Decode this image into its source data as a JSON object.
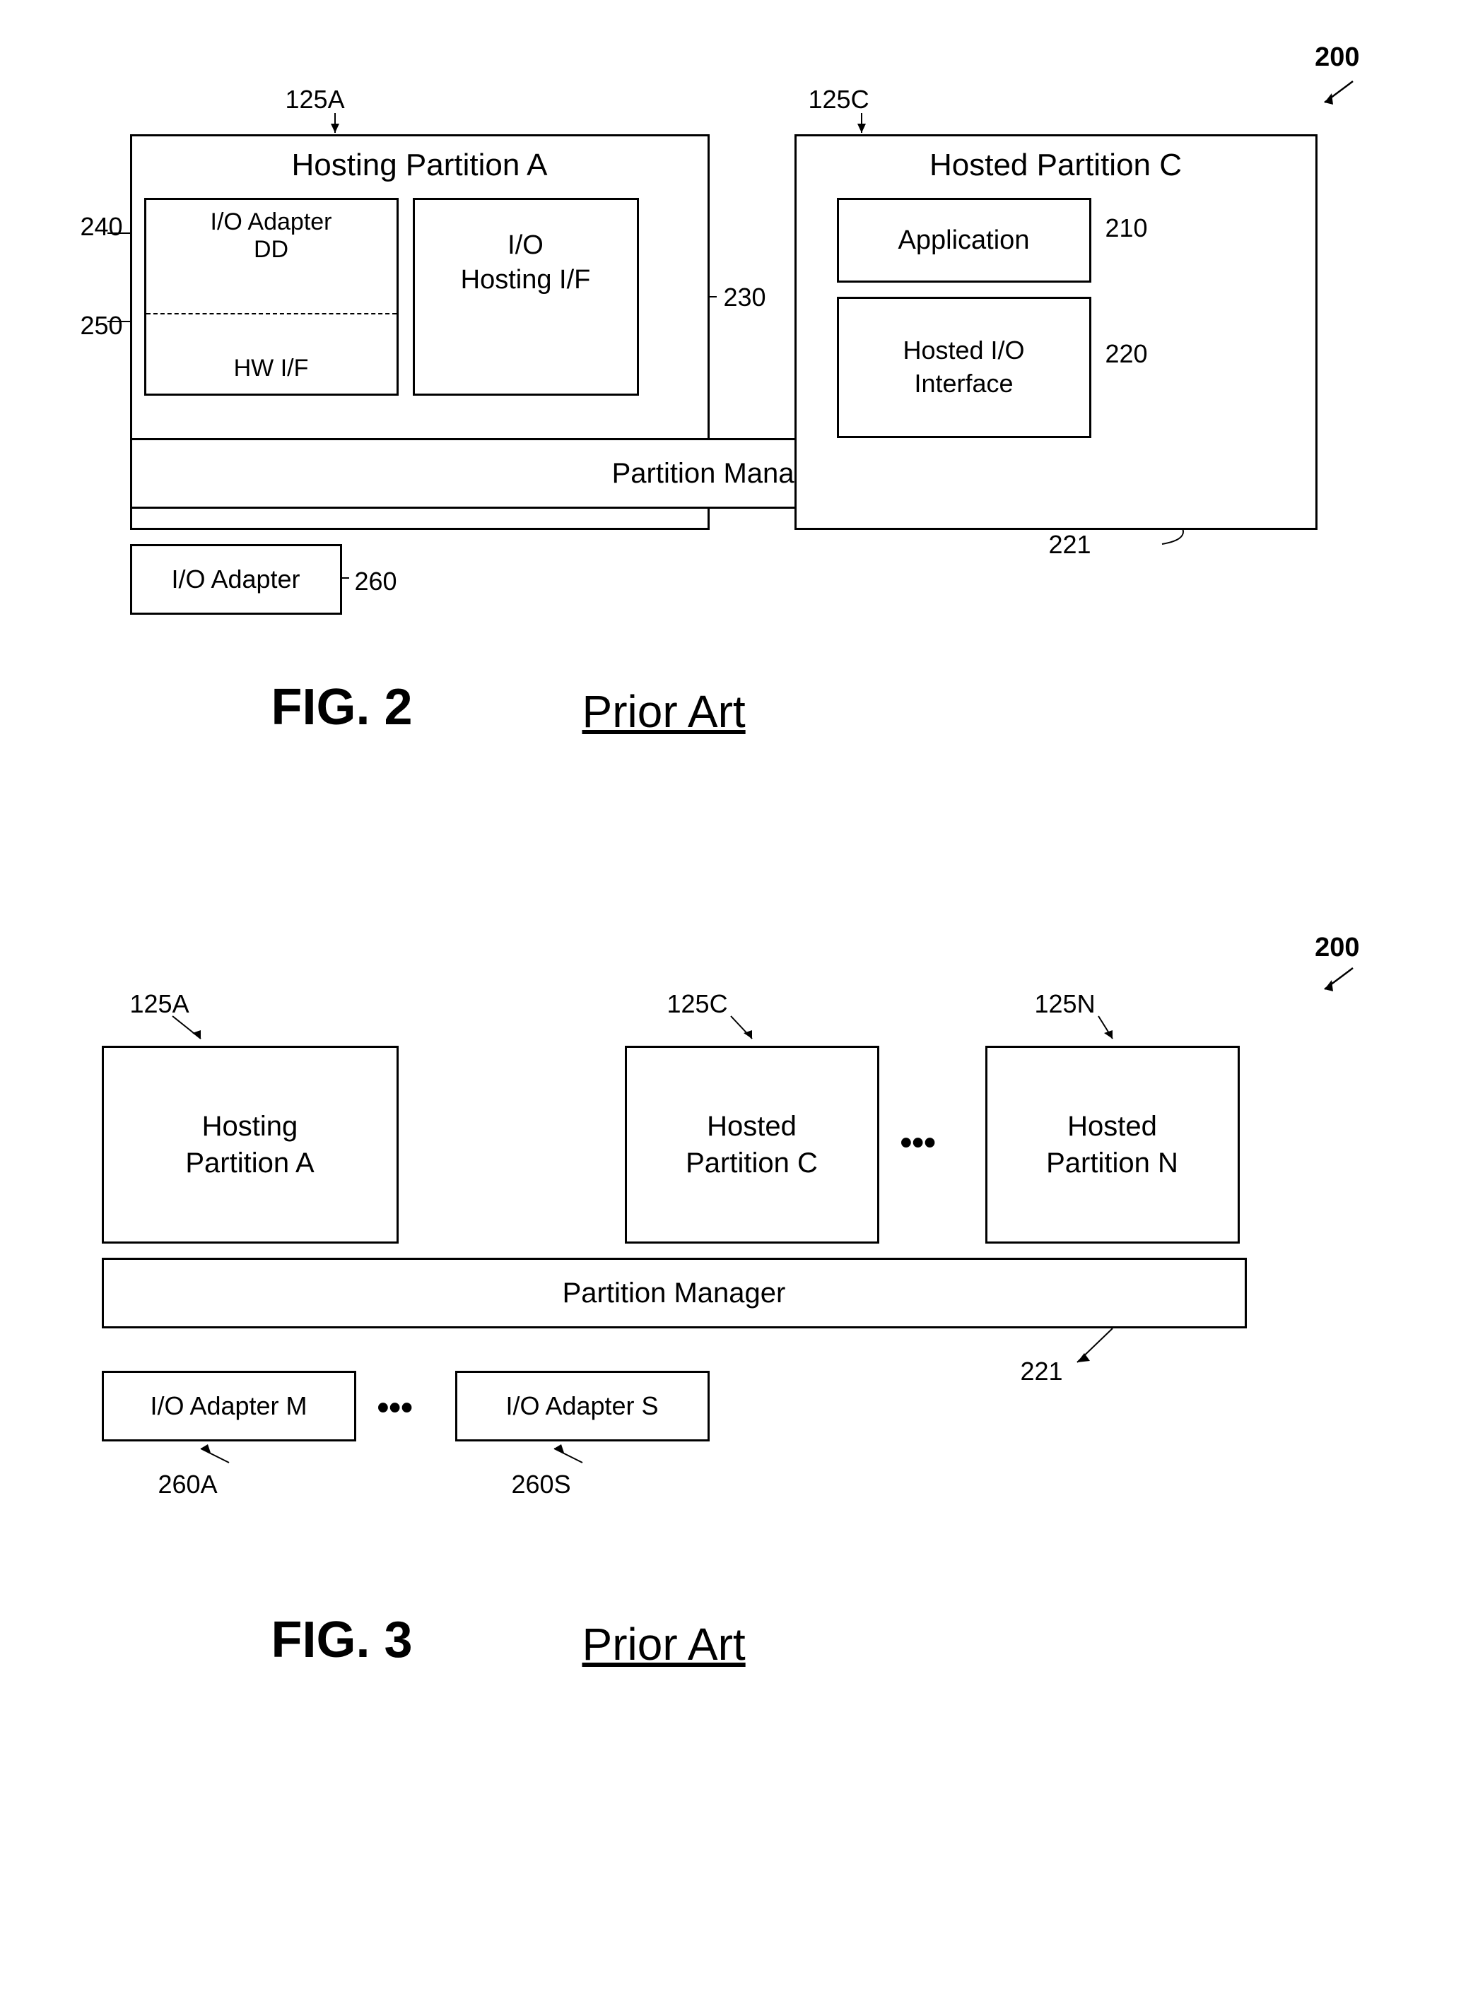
{
  "fig2": {
    "ref_200": "200",
    "label_125a": "125A",
    "label_125c": "125C",
    "hosting_partition_a": {
      "title": "Hosting Partition A"
    },
    "hosted_partition_c": {
      "title": "Hosted Partition C"
    },
    "io_adapter_dd": {
      "line1": "I/O Adapter",
      "line2": "DD"
    },
    "hw_if": "HW I/F",
    "io_hosting_if": "I/O\nHosting I/F",
    "partition_manager": "Partition Manager",
    "application": "Application",
    "hosted_io_interface": "Hosted I/O\nInterface",
    "io_adapter_bottom": "I/O Adapter",
    "label_230": "230",
    "label_240": "240",
    "label_250": "250",
    "label_210": "210",
    "label_220": "220",
    "label_221": "221",
    "label_260": "260",
    "fig_label": "FIG. 2",
    "prior_art": "Prior Art"
  },
  "fig3": {
    "ref_200": "200",
    "label_125a": "125A",
    "label_125c": "125C",
    "label_125n": "125N",
    "hosting_partition_a": "Hosting\nPartition A",
    "hosted_partition_c": "Hosted\nPartition C",
    "hosted_partition_n": "Hosted\nPartition N",
    "partition_manager": "Partition Manager",
    "io_adapter_m": "I/O Adapter M",
    "io_adapter_s": "I/O Adapter S",
    "label_221": "221",
    "label_260a": "260A",
    "label_260s": "260S",
    "ellipsis_partitions": "•••",
    "ellipsis_adapters": "•••",
    "fig_label": "FIG. 3",
    "prior_art": "Prior Art"
  }
}
